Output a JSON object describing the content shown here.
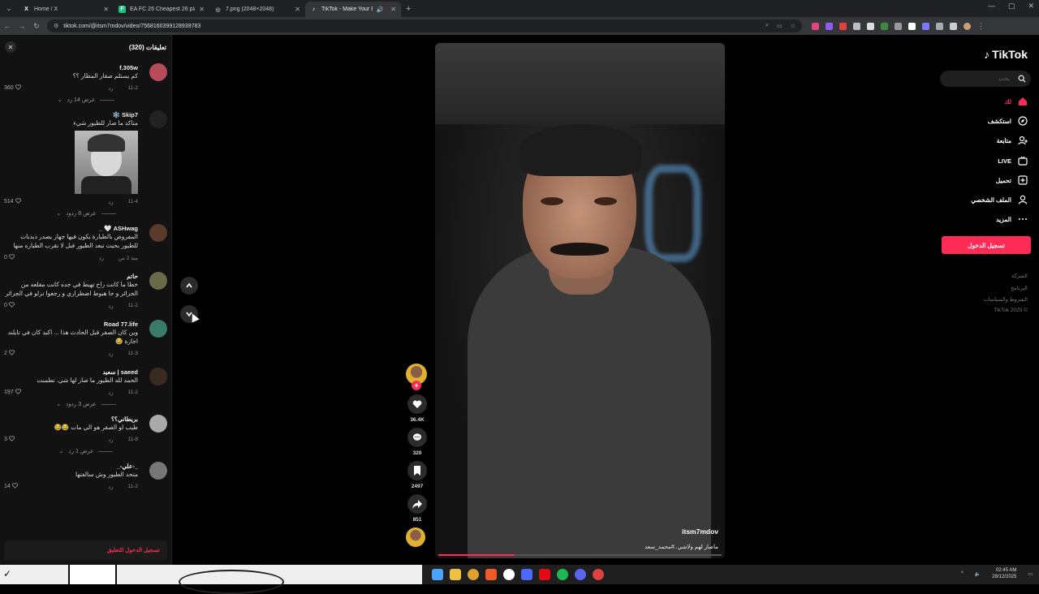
{
  "browser": {
    "tabs": [
      {
        "title": "Home / X",
        "favicon": "X",
        "color": "#000000"
      },
      {
        "title": "EA FC 26 Cheapest 26 players |",
        "favicon": "F",
        "color": "#19c37d"
      },
      {
        "title": "7.png (2048×2048)",
        "favicon": "◎",
        "color": "#666666"
      },
      {
        "title": "TikTok - Make Your Day",
        "favicon": "♪",
        "color": "#000000"
      }
    ],
    "url": "tiktok.com/@itsm7mdov/video/7568160399128939783",
    "new_tab": "+"
  },
  "comments": {
    "title": "تعليقات (320)",
    "login_cta": "تسجيل الدخول للتعليق",
    "items": [
      {
        "user": "f.305w",
        "text": "كم يستلم صقار المطار ؟؟",
        "date": "11-2",
        "reply": "رد",
        "likes": "360",
        "replies": "عرض 14 رد",
        "avatar": "#b84a5a"
      },
      {
        "user": "Skip7 ❄️",
        "text": "متاكد ما صار للطيور شيء",
        "date": "11-4",
        "reply": "رد",
        "likes": "514",
        "replies": "عرض 8 ردود",
        "avatar": "#222222",
        "has_image": true
      },
      {
        "user": "ASHwag 🤍 _",
        "text": "المفروض بالطيارة يكون فيها جهاز يصدر ذبذبات للطيور بحيث تبعد الطيور قبل لا تقرب الطياره منها",
        "date": "منذ 2 س",
        "reply": "رد",
        "likes": "0",
        "replies": "",
        "avatar": "#5a3a2a"
      },
      {
        "user": "حاتم",
        "text": "خطا ما كانت راح تهبط في جده كانت مقلعه من الجزائر و جا هبوط اضطراري و رجعوا نزلو في الجزائر",
        "date": "11-2",
        "reply": "رد",
        "likes": "0",
        "replies": "",
        "avatar": "#6a6a4a"
      },
      {
        "user": "Road 77.life",
        "text": "وين كان الصقر قبل الحادث هذا ... اكيد كان في تايلند اجازة 😂",
        "date": "11-3",
        "reply": "رد",
        "likes": "2",
        "replies": "",
        "avatar": "#3a7a6a"
      },
      {
        "user": "saeed | سعيد",
        "text": "الحمد لله الطيور ما صار لها شي. تطمنت",
        "date": "11-2",
        "reply": "رد",
        "likes": "197",
        "replies": "عرض 3 ردود",
        "avatar": "#3a2a20"
      },
      {
        "user": "بريطاني؟؟",
        "text": "طيب لو الصقر هو الي مات 😂😂",
        "date": "11-8",
        "reply": "رد",
        "likes": "3",
        "replies": "عرض 1 رد",
        "avatar": "#aaaaaa"
      },
      {
        "user": "_-علي-_",
        "text": "متحد الطيور وش سالفتها",
        "date": "11-2",
        "reply": "رد",
        "likes": "14",
        "replies": "",
        "avatar": "#777777"
      }
    ]
  },
  "video": {
    "username": "itsm7mdov",
    "caption": "ماصار لهم ولاشي..#محمد_سعد",
    "progress": 0.27
  },
  "actions": {
    "likes": "36.4K",
    "comments": "320",
    "saves": "2497",
    "shares": "851"
  },
  "sidebar": {
    "logo": "TikTok",
    "search_placeholder": "بحث",
    "nav": [
      {
        "label": "لك",
        "icon": "home-icon",
        "active": true
      },
      {
        "label": "استكشف",
        "icon": "compass-icon"
      },
      {
        "label": "متابعة",
        "icon": "user-plus-icon"
      },
      {
        "label": "LIVE",
        "icon": "live-icon"
      },
      {
        "label": "تحميل",
        "icon": "upload-icon"
      },
      {
        "label": "الملف الشخصي",
        "icon": "profile-icon"
      },
      {
        "label": "المزيد",
        "icon": "more-icon"
      }
    ],
    "login": "تسجيل الدخول",
    "footer": [
      "الشركة",
      "البرنامج",
      "الشروط والسياسات",
      "© 2025 TikTok"
    ],
    "accent": "#fe2c55"
  },
  "taskbar": {
    "time": "02:45 AM",
    "date": "28/12/2025"
  }
}
